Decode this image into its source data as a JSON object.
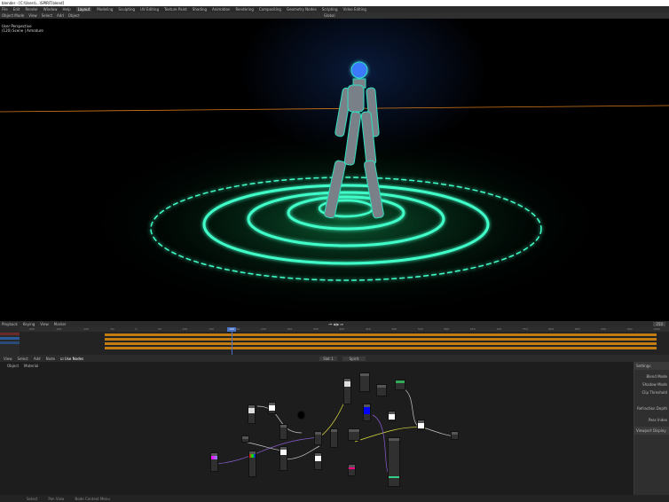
{
  "window": {
    "title": "blender - [C:\\Users\\...\\SPIRIT.blend]"
  },
  "menu": [
    "File",
    "Edit",
    "Render",
    "Window",
    "Help"
  ],
  "workspaces": [
    "Layout",
    "Modeling",
    "Sculpting",
    "UV Editing",
    "Texture Paint",
    "Shading",
    "Animation",
    "Rendering",
    "Compositing",
    "Geometry Nodes",
    "Scripting",
    "Video Editing"
  ],
  "active_workspace": "Layout",
  "viewport": {
    "header": [
      "Object Mode",
      "View",
      "Select",
      "Add",
      "Object"
    ],
    "transform": "Global",
    "info_line1": "User Perspective",
    "info_line2": "(120) Scene | Armature"
  },
  "timeline": {
    "menu": [
      "Playback",
      "Keying",
      "View",
      "Marker"
    ],
    "current_frame": "120",
    "end_frame": "250",
    "ticks": [
      "-200",
      "-150",
      "-100",
      "-50",
      "0",
      "50",
      "100",
      "150",
      "200",
      "250",
      "300",
      "350",
      "400",
      "450",
      "500",
      "550",
      "600",
      "650",
      "700",
      "750",
      "800",
      "850",
      "900",
      "950",
      "1000"
    ]
  },
  "node_editor": {
    "menu": [
      "View",
      "Select",
      "Add",
      "Node"
    ],
    "use_nodes_label": "Use Nodes",
    "slot": "Slot 1",
    "material": "Spirit",
    "breadcrumb": [
      "Object",
      "Material"
    ]
  },
  "npanel": {
    "section": "Settings",
    "rows": [
      "Blend Mode",
      "Shadow Mode",
      "Clip Threshold",
      "Refraction Depth",
      "Pass Index"
    ],
    "subsection": "Viewport Display"
  },
  "status": [
    "Select",
    "Pan View",
    "Node Context Menu"
  ],
  "colors": {
    "glow": "#2fffc0",
    "keyframe_bar": "#c27c12",
    "playhead": "#4a72c4"
  }
}
